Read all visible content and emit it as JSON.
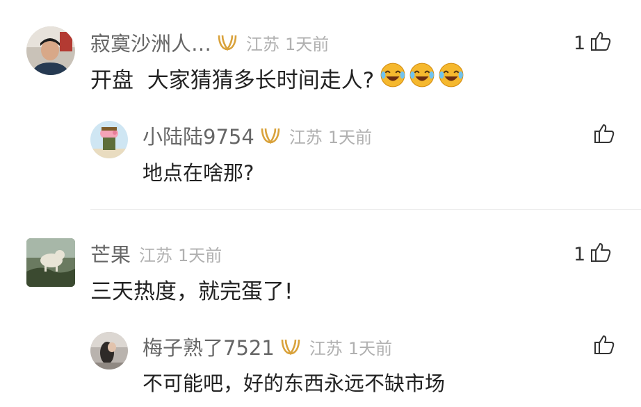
{
  "comments": [
    {
      "username": "寂寞沙洲人…",
      "location": "江苏",
      "time": "1天前",
      "text": "开盘  大家猜猜多长时间走人?",
      "likes": "1",
      "reply": {
        "username": "小陆陆9754",
        "location": "江苏",
        "time": "1天前",
        "text": "地点在啥那?"
      }
    },
    {
      "username": "芒果",
      "location": "江苏",
      "time": "1天前",
      "text": "三天热度，就完蛋了!",
      "likes": "1",
      "reply": {
        "username": "梅子熟了7521",
        "location": "江苏",
        "time": "1天前",
        "text": "不可能吧，好的东西永远不缺市场"
      }
    }
  ],
  "icons": {
    "badge": "vip-badge-icon",
    "like": "thumbs-up-icon",
    "emoji": "crying-laughing-emoji"
  },
  "colors": {
    "badge_gold": "#d9a23b",
    "emoji_yellow": "#f5b82e",
    "username": "#666666",
    "meta": "#b0b0b0",
    "text": "#222222"
  }
}
